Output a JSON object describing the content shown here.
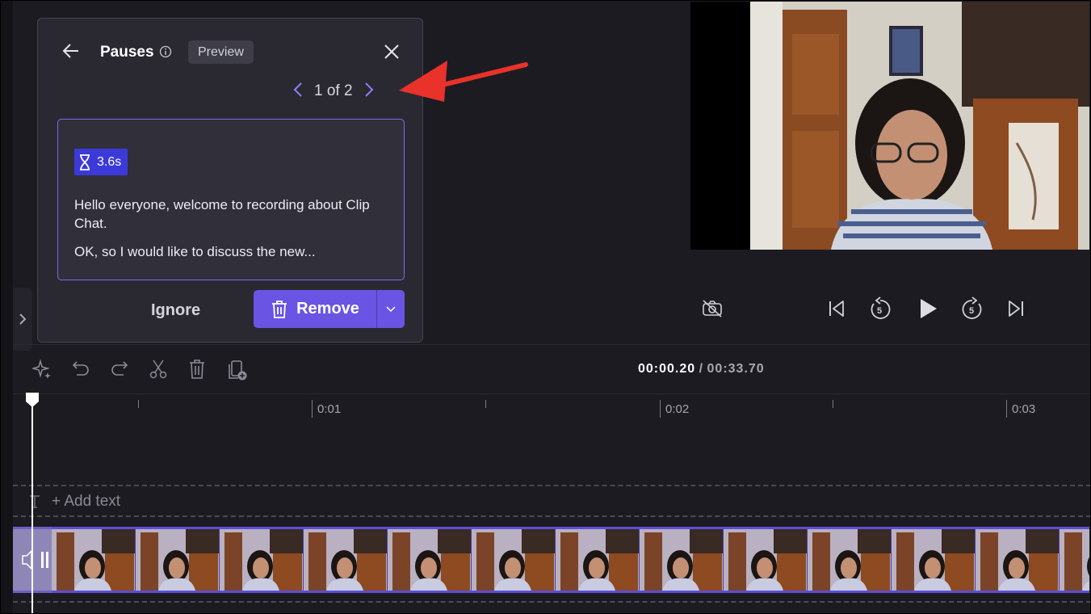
{
  "panel": {
    "title": "Pauses",
    "badge": "Preview",
    "pager": {
      "count": "1 of 2"
    },
    "pause_item": {
      "duration": "3.6s",
      "line1": "Hello everyone, welcome to recording about Clip Chat.",
      "line2": "OK, so I would like to discuss the new..."
    },
    "ignore_label": "Ignore",
    "remove_label": "Remove"
  },
  "timeline": {
    "current_time": "00:00.20",
    "separator": "/",
    "total_time": "00:33.70",
    "ruler_labels": [
      "0:01",
      "0:02",
      "0:03"
    ],
    "add_text_label": "+ Add text"
  },
  "colors": {
    "accent": "#6a54e3",
    "duration_badge": "#3b3ad8",
    "annotation_arrow": "#e8322a",
    "card_border": "#7a6cf0"
  },
  "icons": {
    "player": [
      "camera-off-icon",
      "skip-to-start-icon",
      "rewind-5-icon",
      "play-icon",
      "forward-5-icon",
      "skip-to-end-icon"
    ],
    "toolbar": [
      "magic-sparkle-icon",
      "undo-icon",
      "redo-icon",
      "scissors-icon",
      "trash-icon",
      "copy-add-icon"
    ]
  }
}
